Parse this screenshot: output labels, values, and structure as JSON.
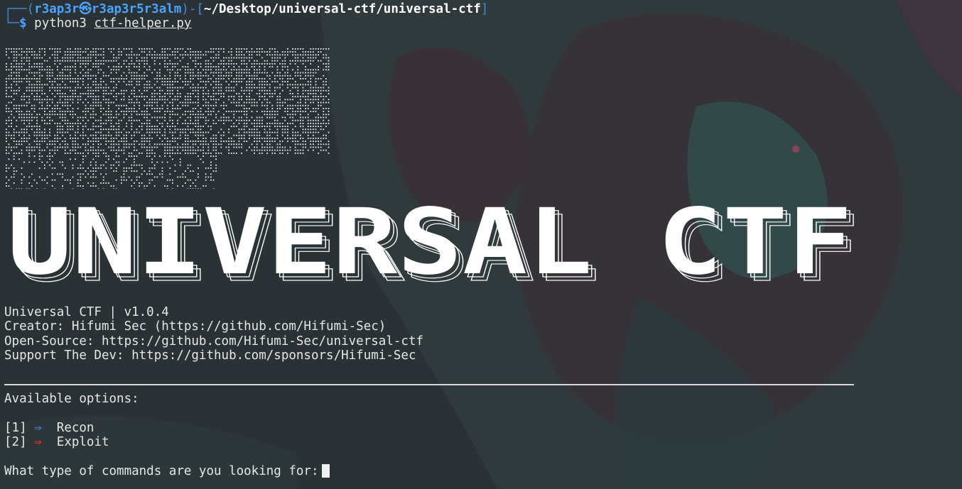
{
  "prompt": {
    "open": "┌──(",
    "user": "r3ap3r㉿r3ap3r5r3alm",
    "mid": ")-[",
    "path": "~/Desktop/universal-ctf/universal-ctf",
    "close": "]",
    "corner": "└─",
    "dollar": "$",
    "command": "python3",
    "argument": "ctf-helper.py"
  },
  "banner": {
    "title": "UNIVERSAL CTF"
  },
  "info": {
    "line1": "Universal CTF | v1.0.4",
    "line2": "Creator: Hifumi Sec (https://github.com/Hifumi-Sec)",
    "line3": "Open-Source: https://github.com/Hifumi-Sec/universal-ctf",
    "line4": "Support The Dev: https://github.com/sponsors/Hifumi-Sec"
  },
  "options": {
    "heading": "Available options:",
    "items": [
      {
        "key": "[1]",
        "arrow": "⇒",
        "label": "Recon",
        "arrow_color": "#3f8bff"
      },
      {
        "key": "[2]",
        "arrow": "⇒",
        "label": "Exploit",
        "arrow_color": "#ff2d2d"
      }
    ]
  },
  "input": {
    "question": "What type of commands are you looking for:"
  },
  "colors": {
    "background": "#2a3236",
    "prompt_accent": "#3f8bd6",
    "text": "#e6e6e6"
  }
}
